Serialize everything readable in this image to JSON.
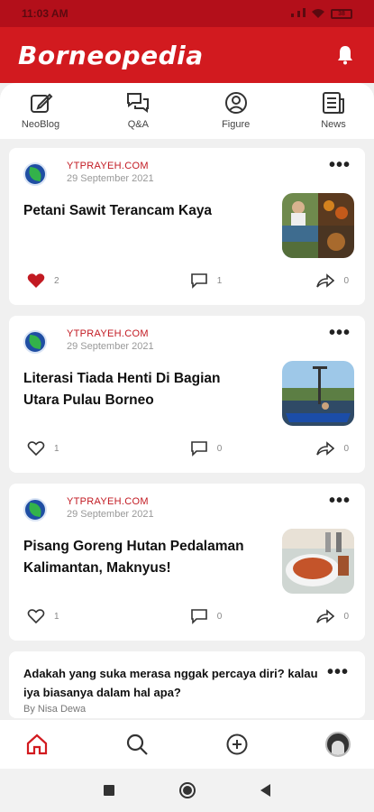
{
  "status": {
    "time": "11:03 AM",
    "battery": "38"
  },
  "app": {
    "title": "Borneopedia"
  },
  "tabs": [
    {
      "label": "NeoBlog"
    },
    {
      "label": "Q&A"
    },
    {
      "label": "Figure"
    },
    {
      "label": "News"
    }
  ],
  "articles": [
    {
      "source": "YTPRAYEH.COM",
      "date": "29 September 2021",
      "title": "Petani Sawit Terancam Kaya",
      "likes": "2",
      "liked": true,
      "comments": "1",
      "shares": "0"
    },
    {
      "source": "YTPRAYEH.COM",
      "date": "29 September 2021",
      "title": "Literasi Tiada Henti Di Bagian Utara Pulau Borneo",
      "likes": "1",
      "liked": false,
      "comments": "0",
      "shares": "0"
    },
    {
      "source": "YTPRAYEH.COM",
      "date": "29 September 2021",
      "title": "Pisang Goreng Hutan Pedalaman Kalimantan, Maknyus!",
      "likes": "1",
      "liked": false,
      "comments": "0",
      "shares": "0"
    }
  ],
  "question": {
    "title": "Adakah yang suka merasa nggak percaya diri? kalau iya biasanya dalam hal apa?",
    "author": "By Nisa Dewa"
  },
  "colors": {
    "brand": "#d21a1f",
    "like": "#c21a22"
  }
}
